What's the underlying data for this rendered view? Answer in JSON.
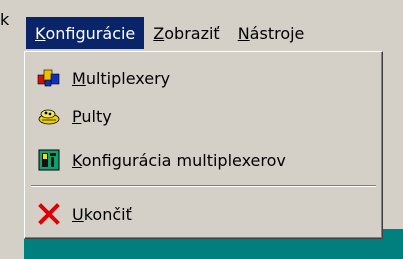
{
  "window": {
    "title_fragment": "k"
  },
  "menubar": {
    "items": [
      {
        "accesskey": "K",
        "rest": "onfigurácie",
        "active": true
      },
      {
        "accesskey": "Z",
        "rest": "obraziť",
        "active": false
      },
      {
        "accesskey": "N",
        "rest": "ástroje",
        "active": false
      }
    ]
  },
  "dropdown": {
    "items": [
      {
        "icon": "multiplexer-icon",
        "accesskey": "M",
        "rest": "ultiplexery"
      },
      {
        "icon": "console-icon",
        "accesskey": "P",
        "rest": "ulty"
      },
      {
        "icon": "multiplexer-config-icon",
        "accesskey": "K",
        "rest": "onfigurácia multiplexerov"
      },
      {
        "icon": "exit-icon",
        "accesskey": "U",
        "rest": "končiť"
      }
    ]
  },
  "colors": {
    "menu_face": "#d4d0c8",
    "selection": "#0a246a",
    "desktop_teal": "#007f7f",
    "exit_red": "#e00000"
  }
}
